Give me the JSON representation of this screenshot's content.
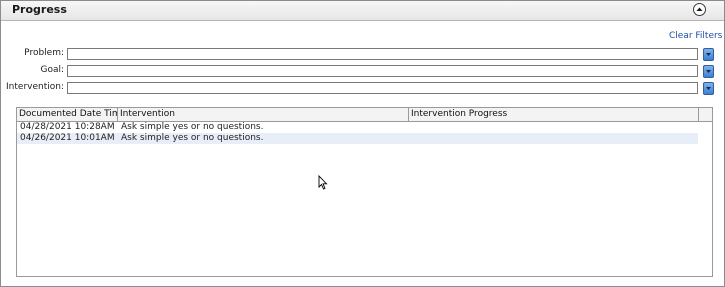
{
  "header": {
    "title": "Progress"
  },
  "filters": {
    "clear_label": "Clear Filters",
    "problem_label": "Problem:",
    "goal_label": "Goal:",
    "intervention_label": "Intervention:",
    "problem_value": "",
    "goal_value": "",
    "intervention_value": ""
  },
  "table": {
    "columns": [
      "Documented Date Time",
      "Intervention",
      "Intervention Progress"
    ],
    "rows": [
      {
        "date": "04/28/2021 10:28AM",
        "intervention": "Ask simple yes or no questions.",
        "progress": ""
      },
      {
        "date": "04/26/2021 10:01AM",
        "intervention": "Ask simple yes or no questions.",
        "progress": ""
      }
    ]
  },
  "colors": {
    "link": "#1f4fa8",
    "dropdown": "#3d7fcf",
    "row_alt": "#e8eef8"
  },
  "icons": {
    "collapse": "chevron-up-circle-icon",
    "dropdown": "caret-down-icon",
    "cursor": "mouse-pointer-icon"
  }
}
